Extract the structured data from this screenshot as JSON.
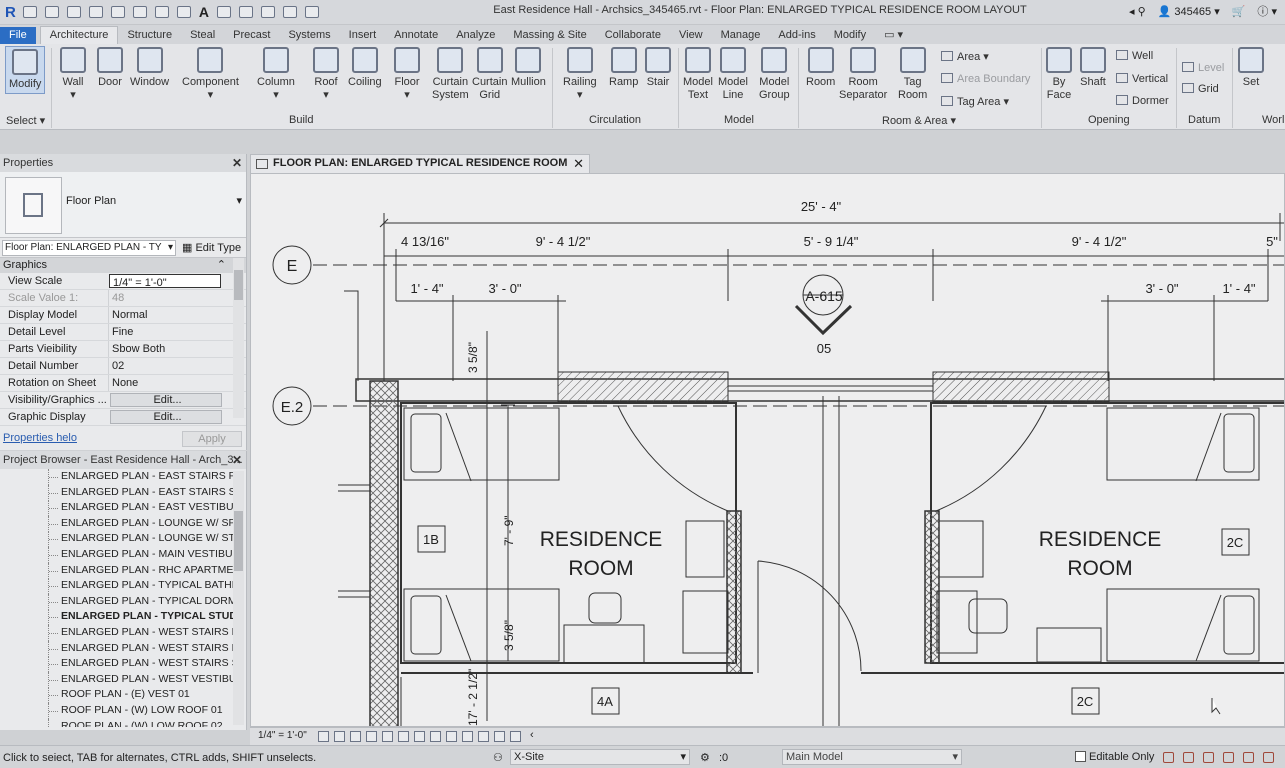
{
  "app": {
    "window_title": "East Residence Hall - Archsics_345465.rvt - Floor Plan: ENLARGED TYPICAL RESIDENCE ROOM LAYOUT",
    "user": "345465",
    "logo": "R",
    "quick_access_letter": "A"
  },
  "ribbon_tabs": [
    "File",
    "Architecture",
    "Structure",
    "Steal",
    "Precast",
    "Systems",
    "Insert",
    "Annotate",
    "Analyze",
    "Massing & Site",
    "Collaborate",
    "View",
    "Manage",
    "Add-ins",
    "Modify"
  ],
  "active_tab": "Architecture",
  "ribbon": {
    "modify": "Modify",
    "select": "Select",
    "build": {
      "label": "Build",
      "wall": "Wall",
      "door": "Door",
      "window": "Window",
      "component": "Component",
      "column": "Column",
      "roof": "Roof",
      "ceiling": "Coiling",
      "floor": "Floor",
      "curtain_system": [
        "Curtain",
        "System"
      ],
      "curtain_grid": [
        "Curtain",
        "Grid"
      ],
      "mullion": "Mullion"
    },
    "circulation": {
      "label": "Circulation",
      "railing": "Railing",
      "ramp": "Ramp",
      "stair": "Stair"
    },
    "model": {
      "label": "Model",
      "model_text": [
        "Model",
        "Text"
      ],
      "model_line": [
        "Model",
        "Line"
      ],
      "model_group": [
        "Model",
        "Group"
      ]
    },
    "room_area": {
      "label": "Room & Area",
      "room": "Room",
      "room_separator": [
        "Room",
        "Separator"
      ],
      "tag_room": [
        "Tag",
        "Room"
      ],
      "area": "Area",
      "area_boundary": "Area  Boundary",
      "tag_area": "Tag  Area"
    },
    "opening": {
      "label": "Opening",
      "by_face": [
        "By",
        "Face"
      ],
      "shaft": "Shaft",
      "wall": "Well",
      "vertical": "Vertical",
      "dormer": "Dormer"
    },
    "datum": {
      "label": "Datum",
      "level": "Level",
      "grid": "Grid"
    },
    "work": {
      "label": "Worl",
      "set": "Set"
    }
  },
  "properties": {
    "title": "Properties",
    "type_name": "Floor Plan",
    "instance": "Floor Plan: ENLARGED PLAN - TY",
    "edit_type": "Edit Type",
    "group": "Graphics",
    "rows": [
      {
        "key": "View Scale",
        "value": "1/4\" = 1'-0\""
      },
      {
        "key": "Scale Valoe    1:",
        "value": "48"
      },
      {
        "key": "Display Model",
        "value": "Normal"
      },
      {
        "key": "Detail Level",
        "value": "Fine"
      },
      {
        "key": "Parts Vieibility",
        "value": "Sbow Both"
      },
      {
        "key": "Detail Number",
        "value": "02"
      },
      {
        "key": "Rotation on Sheet",
        "value": "None"
      },
      {
        "key": "Visibility/Graphics ...",
        "value": "Edit..."
      },
      {
        "key": "Graphic Display Opt...",
        "value": "Edit..."
      }
    ],
    "help_link": "Properties helo",
    "apply": "Apply"
  },
  "project_browser": {
    "title": "Project Browser - East Residence Hall - Arch_3...",
    "items": [
      "ENLARGED PLAN - EAST STAIRS FOR",
      "ENLARGED PLAN - EAST STAIRS SEC",
      "ENLARGED PLAN - EAST VESTIBULE",
      "ENLARGED PLAN - LOUNGE W/ SPIR",
      "ENLARGED PLAN - LOUNGE W/ STAI",
      "ENLARGED PLAN - MAIN VESTIBULE",
      "ENLARGED PLAN - RHC APARTMENT",
      "ENLARGED PLAN - TYPICAL BATHRO",
      "ENLARGED PLAN - TYPICAL DORM U",
      "ENLARGED PLAN - TYPICAL STUD",
      "ENLARGED PLAN - WEST STAIRS FIR",
      "ENLARGED PLAN - WEST STAIRS FO",
      "ENLARGED PLAN - WEST STAIRS SEC",
      "ENLARGED PLAN - WEST VESTIBULE",
      "ROOF PLAN - (E) VEST 01",
      "ROOF PLAN - (W) LOW ROOF 01",
      "ROOF PLAN - (W) LOW ROOF 02"
    ],
    "bold_index": 9
  },
  "view_tab": "FLOOR PLAN: ENLARGED TYPICAL RESIDENCE ROOM LAYOUT",
  "drawing": {
    "dim_overall": "25' - 4\"",
    "dims_row2": [
      "4 13/16\"",
      "9' - 4 1/2\"",
      "5' - 9 1/4\"",
      "9' - 4 1/2\"",
      "5\""
    ],
    "dims_row3_left": [
      "1' - 4\"",
      "3' - 0\""
    ],
    "dims_row3_right": [
      "3' - 0\"",
      "1' - 4\""
    ],
    "vert_dims": [
      "3 5/8\"",
      "7' - 9\"",
      "3 5/8\"",
      "17' - 2 1/2\""
    ],
    "grid_e": "E",
    "grid_e2": "E.2",
    "section_ref": "A-615",
    "section_num": "05",
    "room_label": [
      "RESIDENCE",
      "ROOM"
    ],
    "tags": [
      "1B",
      "2C",
      "4A",
      "2C"
    ]
  },
  "view_bar": {
    "scale": "1/4\" = 1'-0\""
  },
  "status": {
    "hint": "Click to seiect, TAB for alternates, CTRL adds, SHIFT unselects.",
    "workset": "X-Site",
    "design_option": ":0",
    "model": "Main Model",
    "editable_only": "Editable Only"
  }
}
